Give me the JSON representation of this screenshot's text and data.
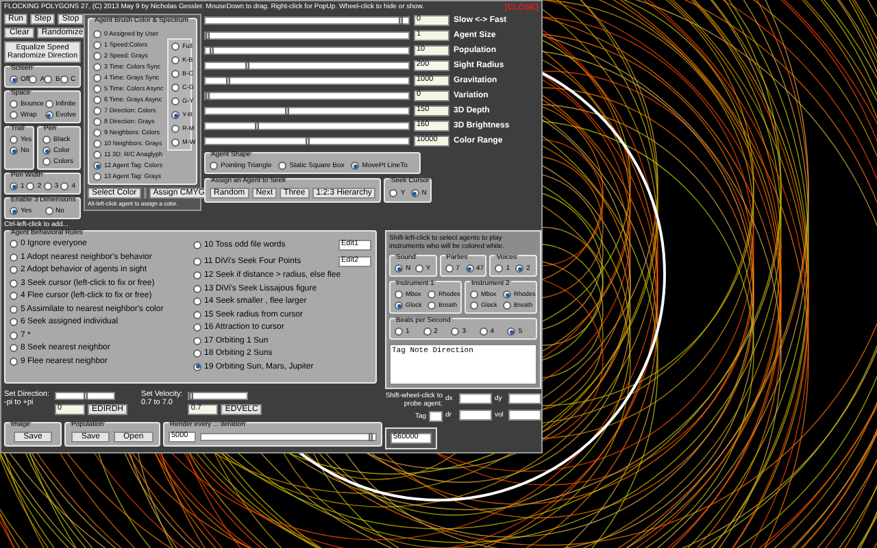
{
  "window": {
    "title": "FLOCKING POLYGONS 27, (C) 2013 May 9 by Nicholas Gessler.   MouseDown to drag.  Right-click for PopUp.  Wheel-click to hide or show.",
    "close": "[CLOSE]"
  },
  "run_buttons": [
    "Run",
    "Step",
    "Stop"
  ],
  "clear_buttons": [
    "Clear",
    "Randomize"
  ],
  "equalize_button": [
    "Equalize Speed",
    "Randomize Direction"
  ],
  "screen": {
    "title": "Screen",
    "options": [
      {
        "label": "Off",
        "selected": true
      },
      {
        "label": "A",
        "selected": false
      },
      {
        "label": "B",
        "selected": false
      },
      {
        "label": "C",
        "selected": false
      }
    ]
  },
  "space": {
    "title": "Space",
    "options": [
      {
        "label": "Bounce",
        "selected": false
      },
      {
        "label": "Infinite",
        "selected": false
      },
      {
        "label": "Wrap",
        "selected": false
      },
      {
        "label": "Evolve",
        "selected": true
      }
    ]
  },
  "trail": {
    "title": "Trail",
    "options": [
      {
        "label": "Yes",
        "selected": false
      },
      {
        "label": "No",
        "selected": true
      }
    ]
  },
  "pen": {
    "title": "Pen",
    "options": [
      {
        "label": "Black",
        "selected": false
      },
      {
        "label": "Color",
        "selected": true
      },
      {
        "label": "Colors",
        "selected": false
      }
    ]
  },
  "pen_width": {
    "title": "Pen Width",
    "options": [
      {
        "label": "1",
        "selected": true
      },
      {
        "label": "2",
        "selected": false
      },
      {
        "label": "3",
        "selected": false
      },
      {
        "label": "4",
        "selected": false
      }
    ]
  },
  "dimensions": {
    "title": "Enable 3 Dimensions",
    "options": [
      {
        "label": "Yes",
        "selected": true
      },
      {
        "label": "No",
        "selected": false
      }
    ]
  },
  "ctrl_hint": "Ctrl-left-click to add...",
  "brush": {
    "title": "Agent Brush Color & Spectrum",
    "options": [
      {
        "label": "0 Assigned by User",
        "selected": false
      },
      {
        "label": "1 Speed:Colors",
        "selected": false
      },
      {
        "label": "2 Speed: Grays",
        "selected": false
      },
      {
        "label": "3 Time: Colors Sync",
        "selected": false
      },
      {
        "label": "4 Time: Grays Sync",
        "selected": false
      },
      {
        "label": "5 Time: Colors Async",
        "selected": false
      },
      {
        "label": "6 Time: Grays Async",
        "selected": false
      },
      {
        "label": "7 Direction: Colors",
        "selected": false
      },
      {
        "label": "8 Direction: Grays",
        "selected": false
      },
      {
        "label": "9 Neighbors: Colors",
        "selected": false
      },
      {
        "label": "10 Neighbors: Grays",
        "selected": false
      },
      {
        "label": "11 3D: R/C Anaglyph",
        "selected": false
      },
      {
        "label": "12 Agent Tag: Colors",
        "selected": true
      },
      {
        "label": "13 Agent Tag: Grays",
        "selected": false
      }
    ],
    "spectrum": [
      {
        "label": "Full",
        "selected": false
      },
      {
        "label": "K-B",
        "selected": false
      },
      {
        "label": "B-C",
        "selected": false
      },
      {
        "label": "C-G",
        "selected": false
      },
      {
        "label": "G-Y",
        "selected": false
      },
      {
        "label": "Y-R",
        "selected": true
      },
      {
        "label": "R-M",
        "selected": false
      },
      {
        "label": "M-W",
        "selected": false
      }
    ],
    "select_button": "Select Color",
    "assign_button": "Assign CMYG",
    "hint": "Alt-left-click agent to assign a color."
  },
  "sliders": [
    {
      "value": "0",
      "label": "Slow <-> Fast",
      "level": 0.97
    },
    {
      "value": "1",
      "label": "Agent Size",
      "level": 0.0
    },
    {
      "value": "10",
      "label": "Population",
      "level": 0.02
    },
    {
      "value": "200",
      "label": "Sight Radius",
      "level": 0.2
    },
    {
      "value": "1000",
      "label": "Gravitation",
      "level": 0.1
    },
    {
      "value": "0",
      "label": "Variation",
      "level": 0.0
    },
    {
      "value": "150",
      "label": "3D Depth",
      "level": 0.4
    },
    {
      "value": "160",
      "label": "3D Brightness",
      "level": 0.25
    },
    {
      "value": "10000",
      "label": "Color Range",
      "level": 0.5
    }
  ],
  "agent_shape": {
    "title": "Agent Shape",
    "options": [
      {
        "label": "Pointing Triangle",
        "selected": false
      },
      {
        "label": "Static Square Box",
        "selected": false
      },
      {
        "label": "MovePt LineTo",
        "selected": true
      }
    ]
  },
  "seek": {
    "title": "Assign an Agent to Seek",
    "buttons": [
      "Random",
      "Next",
      "Three",
      "1:2:3 Hierarchy"
    ]
  },
  "seek_cursor": {
    "title": "Seek Cursor",
    "options": [
      {
        "label": "Y",
        "selected": false
      },
      {
        "label": "N",
        "selected": true
      }
    ]
  },
  "rules": {
    "title": "Agent Behavioral Rules",
    "options": [
      {
        "label": "0 Ignore everyone",
        "selected": false
      },
      {
        "label": "1 Adopt nearest neighbor's behavior",
        "selected": false
      },
      {
        "label": "2 Adopt behavior of agents in sight",
        "selected": false
      },
      {
        "label": "3 Seek cursor (left-click to fix or free)",
        "selected": false
      },
      {
        "label": "4 Flee cursor (left-click to fix or free)",
        "selected": false
      },
      {
        "label": "5 Assimilate to nearest neighbor's color",
        "selected": false
      },
      {
        "label": "6 Seek assigned individual",
        "selected": false
      },
      {
        "label": "7 *",
        "selected": false
      },
      {
        "label": "8 Seek nearest neighbor",
        "selected": false
      },
      {
        "label": "9 Flee nearest neighbor",
        "selected": false
      },
      {
        "label": "10 Toss odd file words",
        "selected": false
      },
      {
        "label": "11 DiVi's Seek Four Points",
        "selected": false
      },
      {
        "label": "12 Seek if distance > radius, else flee",
        "selected": false
      },
      {
        "label": "13 DiVi's Seek Lissajous figure",
        "selected": false
      },
      {
        "label": "14 Seek smaller , flee larger",
        "selected": false
      },
      {
        "label": "15 Seek radius from cursor",
        "selected": false
      },
      {
        "label": "16 Attraction to cursor",
        "selected": false
      },
      {
        "label": "17 Orbiting 1 Sun",
        "selected": false
      },
      {
        "label": "18 Orbiting 2 Suns",
        "selected": false
      },
      {
        "label": "19 Orbiting Sun, Mars, Jupiter",
        "selected": true
      }
    ],
    "edits": [
      "Edit1",
      "Edit2"
    ]
  },
  "sound_hint": "Shift-left-click to select agents to play instruments who will be colored white.",
  "sound": {
    "title": "Sound",
    "options": [
      {
        "label": "N",
        "selected": true
      },
      {
        "label": "Y",
        "selected": false
      }
    ]
  },
  "parties": {
    "title": "Parties",
    "options": [
      {
        "label": "7",
        "selected": false
      },
      {
        "label": "47",
        "selected": true
      }
    ]
  },
  "voices": {
    "title": "Voices",
    "options": [
      {
        "label": "1",
        "selected": false
      },
      {
        "label": "2",
        "selected": true
      }
    ]
  },
  "instrument_1": {
    "title": "Instrument 1",
    "options": [
      {
        "label": "Mbox",
        "selected": false
      },
      {
        "label": "Rhodes",
        "selected": false
      },
      {
        "label": "Glock",
        "selected": true
      },
      {
        "label": "Breath",
        "selected": false
      }
    ]
  },
  "instrument_2": {
    "title": "Instrument 2",
    "options": [
      {
        "label": "Mbox",
        "selected": false
      },
      {
        "label": "Rhodes",
        "selected": true
      },
      {
        "label": "Glock",
        "selected": false
      },
      {
        "label": "Breath",
        "selected": false
      }
    ]
  },
  "beats": {
    "title": "Beats per Second",
    "options": [
      {
        "label": "1",
        "selected": false
      },
      {
        "label": "2",
        "selected": false
      },
      {
        "label": "3",
        "selected": false
      },
      {
        "label": "4",
        "selected": false
      },
      {
        "label": "5",
        "selected": true
      }
    ]
  },
  "notes_text": "Tag Note Direction",
  "probe": {
    "hint": "Shift-wheel-click to probe agent.",
    "labels": [
      "dx",
      "dy",
      "Tag",
      "dr",
      "vol"
    ]
  },
  "direction": {
    "label": "Set Direction:",
    "range": "-pi to +pi",
    "level": 0.5,
    "value": "0",
    "button": "EDIRDH"
  },
  "velocity": {
    "label": "Set Velocity:",
    "range": "0.7 to 7.0",
    "level": 0.0,
    "value": "0.7",
    "button": "EDVELC"
  },
  "image": {
    "title": "Image",
    "buttons": [
      "Save"
    ]
  },
  "population": {
    "title": "Population",
    "buttons": [
      "Save",
      "Open"
    ]
  },
  "render": {
    "title": "Render every ... iteration",
    "value": "5000",
    "level": 0.98,
    "end_value": "560000"
  }
}
